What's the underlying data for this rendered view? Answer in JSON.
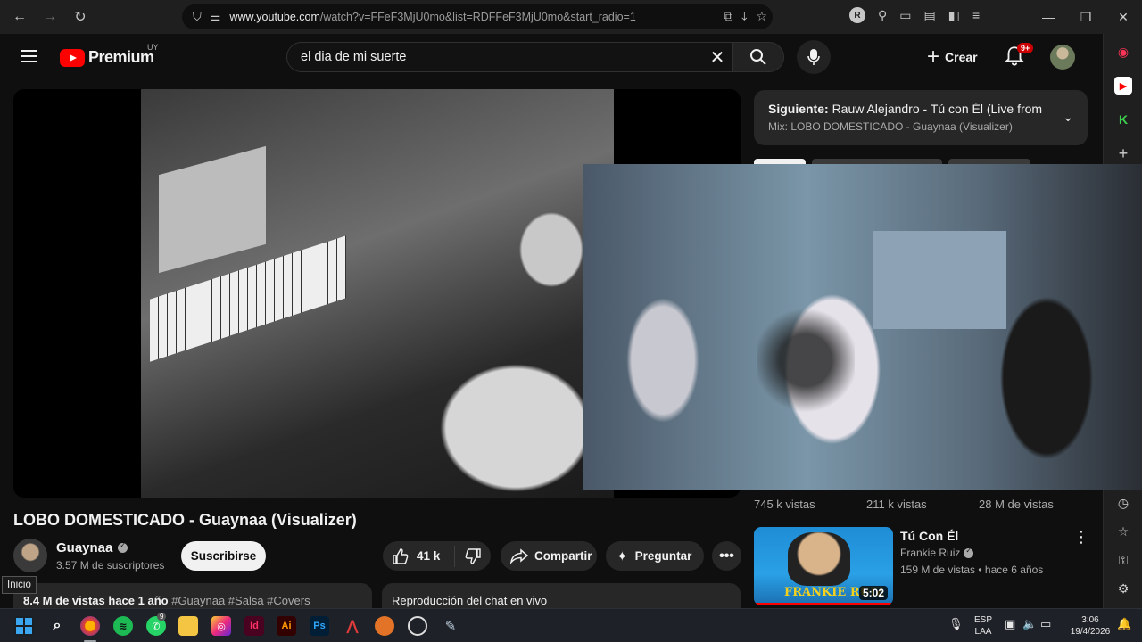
{
  "browser": {
    "url_prefix": "www.youtube.com",
    "url_rest": "/watch?v=FFeF3MjU0mo&list=RDFFeF3MjU0mo&start_radio=1",
    "profile_letter": "R"
  },
  "header": {
    "logo_word": "Premium",
    "country": "UY",
    "search_value": "el dia de mi suerte",
    "create_label": "Crear",
    "notif_badge": "9+"
  },
  "upnext": {
    "prefix": "Siguiente:",
    "title": "Rauw Alejandro - Tú con Él (Live from Ne...",
    "mix": "Mix: LOBO DOMESTICADO - Guaynaa (Visualizer)"
  },
  "views_row": [
    "745 k vistas",
    "211 k vistas",
    "28 M de vistas"
  ],
  "video": {
    "title": "LOBO DOMESTICADO - Guaynaa (Visualizer)",
    "channel": "Guaynaa",
    "subscribers": "3.57 M de suscriptores",
    "subscribe_label": "Suscribirse",
    "likes": "41 k",
    "share_label": "Compartir",
    "ask_label": "Preguntar",
    "desc_stats": "8.4 M de vistas  hace 1 año",
    "desc_tags": "#Guaynaa #Salsa #Covers",
    "chat_label": "Reproducción del chat en vivo",
    "tooltip": "Inicio"
  },
  "recommended": {
    "title": "Tú Con Él",
    "channel": "Frankie Ruiz",
    "meta": "159 M de vistas • hace 6 años",
    "duration": "5:02",
    "thumb_text": "FRANKIE RUIZ"
  },
  "taskbar": {
    "lang": "ESP",
    "lang2": "LAA",
    "time": "3:06",
    "date": "19/4/2026",
    "whatsapp_badge": "9"
  },
  "colors": {
    "accent": "#ff0000",
    "background": "#0f0f0f",
    "surface": "#272727"
  }
}
